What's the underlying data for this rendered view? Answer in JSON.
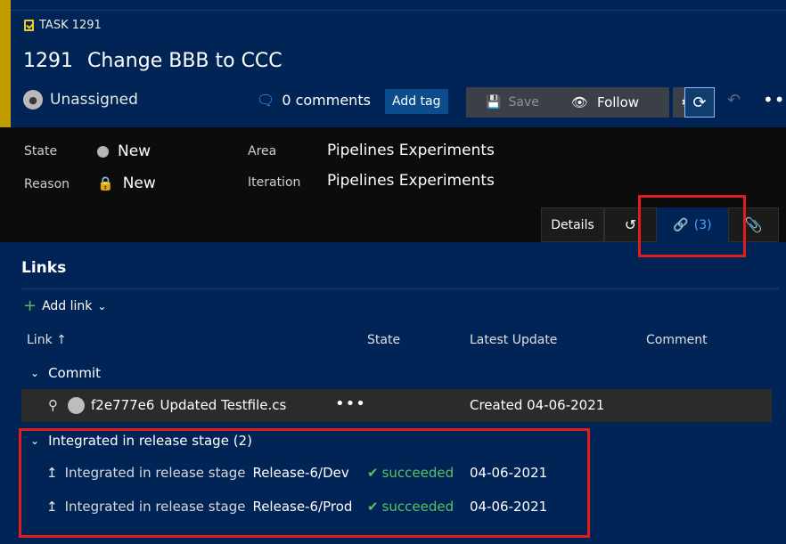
{
  "workitem": {
    "type_label": "TASK 1291",
    "id": "1291",
    "title": "Change BBB to CCC",
    "assignee": "Unassigned",
    "comments_label": "0 comments",
    "add_tag_label": "Add tag",
    "save_label": "Save",
    "follow_label": "Follow"
  },
  "fields": {
    "state_label": "State",
    "state_value": "New",
    "reason_label": "Reason",
    "reason_value": "New",
    "area_label": "Area",
    "area_value": "Pipelines Experiments",
    "iteration_label": "Iteration",
    "iteration_value": "Pipelines Experiments"
  },
  "tabs": {
    "details": "Details",
    "links_count": "(3)"
  },
  "links": {
    "title": "Links",
    "add_link_label": "Add link",
    "columns": {
      "link": "Link ↑",
      "state": "State",
      "latest_update": "Latest Update",
      "comment": "Comment"
    },
    "groups": [
      {
        "name": "Commit",
        "rows": [
          {
            "hash": "f2e777e6",
            "message": "Updated Testfile.cs",
            "latest_update": "Created 04-06-2021"
          }
        ]
      },
      {
        "name": "Integrated in release stage (2)",
        "rows": [
          {
            "prefix": "Integrated in release stage",
            "stage": "Release-6/Dev",
            "state": "succeeded",
            "latest_update": "04-06-2021"
          },
          {
            "prefix": "Integrated in release stage",
            "stage": "Release-6/Prod",
            "state": "succeeded",
            "latest_update": "04-06-2021"
          }
        ]
      }
    ]
  },
  "colors": {
    "background": "#012456",
    "accent_bar": "#c19c00",
    "success": "#57c163",
    "highlight": "#e31b1b",
    "link_blue": "#4aa3ff"
  }
}
